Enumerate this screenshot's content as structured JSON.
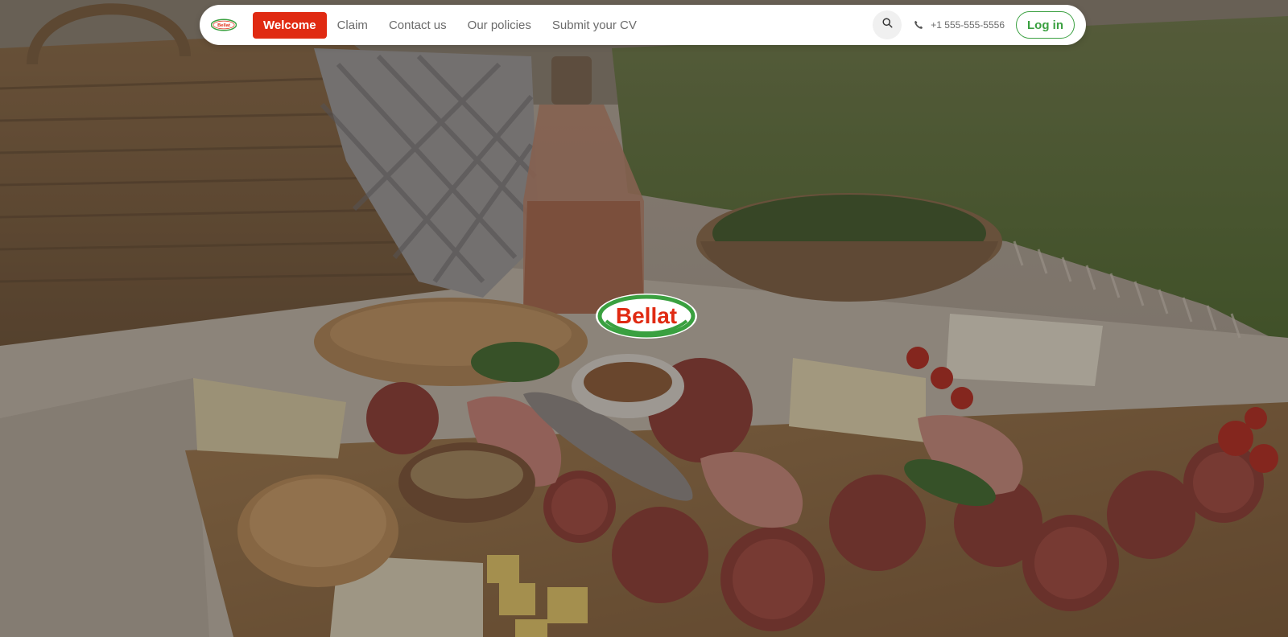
{
  "brand": {
    "name": "Bellat",
    "colors": {
      "red": "#e02a12",
      "green": "#3aa040",
      "white": "#ffffff"
    }
  },
  "navbar": {
    "logo_icon": "bellat-logo",
    "links": [
      {
        "label": "Welcome",
        "active": true
      },
      {
        "label": "Claim",
        "active": false
      },
      {
        "label": "Contact us",
        "active": false
      },
      {
        "label": "Our policies",
        "active": false
      },
      {
        "label": "Submit your CV",
        "active": false
      }
    ],
    "search_icon": "search-icon",
    "phone_icon": "phone-icon",
    "phone_number": "+1 555-555-5556",
    "login_label": "Log in"
  },
  "hero": {
    "logo_icon": "bellat-logo"
  }
}
